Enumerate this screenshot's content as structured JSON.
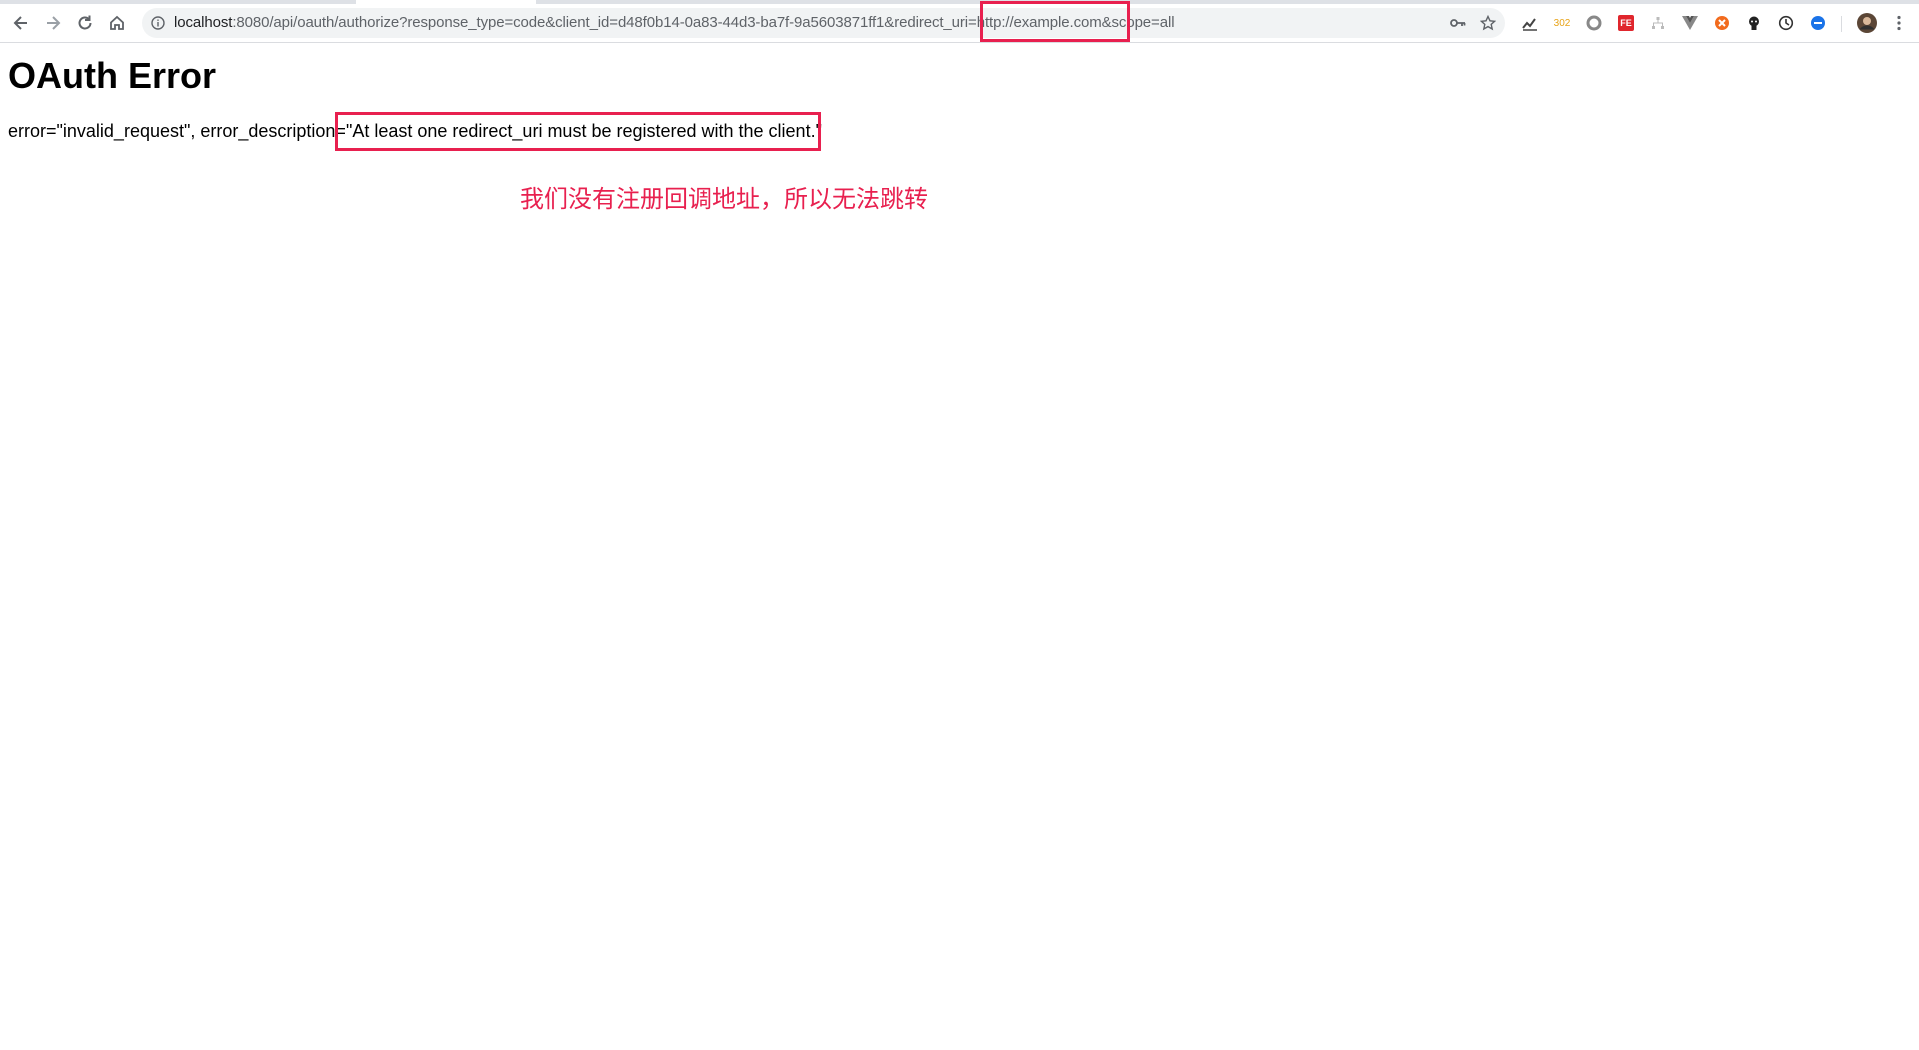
{
  "browser": {
    "url_host": "localhost",
    "url_rest": ":8080/api/oauth/authorize?response_type=code&client_id=d48f0b14-0a83-44d3-ba7f-9a5603871ff1&redirect_uri=http://example.com&scope=all",
    "extensions": {
      "ext_302_label": "302",
      "ext_fe_label": "FE"
    },
    "colors": {
      "tab_strip": "#dee1e6",
      "omnibox": "#f1f3f4"
    }
  },
  "page": {
    "title": "OAuth Error",
    "error_text": "error=\"invalid_request\", error_description=\"At least one redirect_uri must be registered with the client.\""
  },
  "annotation": {
    "text": "我们没有注册回调地址，所以无法跳转",
    "color": "#e8204f"
  }
}
